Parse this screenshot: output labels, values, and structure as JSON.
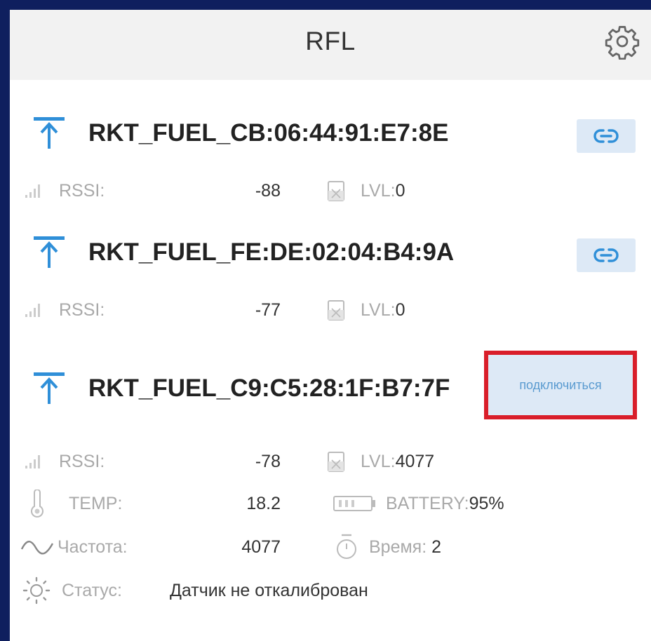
{
  "header": {
    "title": "RFL",
    "settings_icon": "gear-icon"
  },
  "devices": [
    {
      "name": "RKT_FUEL_CB:06:44:91:E7:8E",
      "action_icon": "link-icon",
      "rssi_label": "RSSI:",
      "rssi": "-88",
      "lvl_label": "LVL:",
      "lvl": "0"
    },
    {
      "name": "RKT_FUEL_FE:DE:02:04:B4:9A",
      "action_icon": "link-icon",
      "rssi_label": "RSSI:",
      "rssi": "-77",
      "lvl_label": "LVL:",
      "lvl": "0"
    },
    {
      "name": "RKT_FUEL_C9:C5:28:1F:B7:7F",
      "connect_label": "подключиться",
      "rssi_label": "RSSI:",
      "rssi": "-78",
      "lvl_label": "LVL:",
      "lvl": "4077",
      "temp_label": "TEMP:",
      "temp": "18.2",
      "battery_label": "BATTERY:",
      "battery": "95%",
      "freq_label": "Частота:",
      "freq": "4077",
      "time_label": "Время:",
      "time": "2",
      "status_label": "Статус:",
      "status": "Датчик не откалиброван"
    }
  ],
  "colors": {
    "frame": "#0f1f5e",
    "accent": "#2f8fd8",
    "highlight_border": "#d91e2a",
    "button_bg": "#dde9f6"
  }
}
